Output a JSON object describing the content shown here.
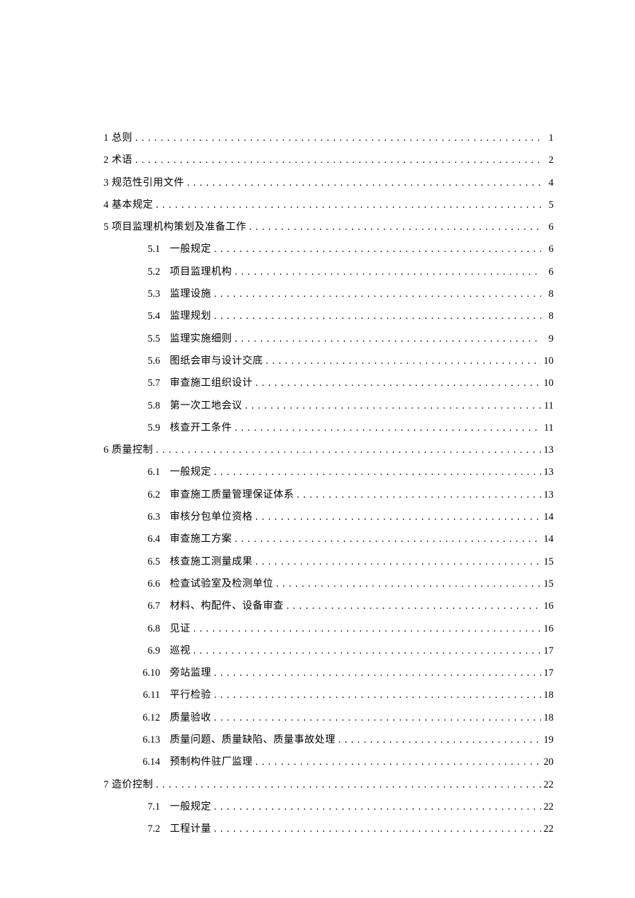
{
  "toc": [
    {
      "level": 1,
      "num": "1",
      "title": "总则",
      "page": "1"
    },
    {
      "level": 1,
      "num": "2",
      "title": "术语",
      "page": "2"
    },
    {
      "level": 1,
      "num": "3",
      "title": "规范性引用文件",
      "page": "4"
    },
    {
      "level": 1,
      "num": "4",
      "title": "基本规定",
      "page": "5"
    },
    {
      "level": 1,
      "num": "5",
      "title": "项目监理机构策划及准备工作",
      "page": "6"
    },
    {
      "level": 2,
      "num": "5.1",
      "title": "一般规定",
      "page": "6"
    },
    {
      "level": 2,
      "num": "5.2",
      "title": "项目监理机构",
      "page": "6"
    },
    {
      "level": 2,
      "num": "5.3",
      "title": "监理设施",
      "page": "8"
    },
    {
      "level": 2,
      "num": "5.4",
      "title": "监理规划",
      "page": "8"
    },
    {
      "level": 2,
      "num": "5.5",
      "title": "监理实施细则",
      "page": "9"
    },
    {
      "level": 2,
      "num": "5.6",
      "title": "图纸会审与设计交底",
      "page": "10"
    },
    {
      "level": 2,
      "num": "5.7",
      "title": "审查施工组织设计",
      "page": "10"
    },
    {
      "level": 2,
      "num": "5.8",
      "title": "第一次工地会议",
      "page": "11"
    },
    {
      "level": 2,
      "num": "5.9",
      "title": "核查开工条件",
      "page": "11"
    },
    {
      "level": 1,
      "num": "6",
      "title": "质量控制",
      "page": "13"
    },
    {
      "level": 2,
      "num": "6.1",
      "title": "一般规定",
      "page": "13"
    },
    {
      "level": 2,
      "num": "6.2",
      "title": "审查施工质量管理保证体系",
      "page": "13"
    },
    {
      "level": 2,
      "num": "6.3",
      "title": "审核分包单位资格",
      "page": "14"
    },
    {
      "level": 2,
      "num": "6.4",
      "title": "审查施工方案",
      "page": "14"
    },
    {
      "level": 2,
      "num": "6.5",
      "title": "核查施工测量成果",
      "page": "15"
    },
    {
      "level": 2,
      "num": "6.6",
      "title": "检查试验室及检测单位",
      "page": "15"
    },
    {
      "level": 2,
      "num": "6.7",
      "title": "材料、构配件、设备审查",
      "page": "16"
    },
    {
      "level": 2,
      "num": "6.8",
      "title": "见证",
      "page": "16"
    },
    {
      "level": 2,
      "num": "6.9",
      "title": "巡视",
      "page": "17"
    },
    {
      "level": 2,
      "num": "6.10",
      "title": "旁站监理",
      "page": "17"
    },
    {
      "level": 2,
      "num": "6.11",
      "title": "平行检验",
      "page": "18"
    },
    {
      "level": 2,
      "num": "6.12",
      "title": "质量验收",
      "page": "18"
    },
    {
      "level": 2,
      "num": "6.13",
      "title": "质量问题、质量缺陷、质量事故处理",
      "page": "19"
    },
    {
      "level": 2,
      "num": "6.14",
      "title": "预制构件驻厂监理",
      "page": "20"
    },
    {
      "level": 1,
      "num": "7",
      "title": "造价控制",
      "page": "22"
    },
    {
      "level": 2,
      "num": "7.1",
      "title": "一般规定",
      "page": "22"
    },
    {
      "level": 2,
      "num": "7.2",
      "title": "工程计量",
      "page": "22"
    }
  ]
}
